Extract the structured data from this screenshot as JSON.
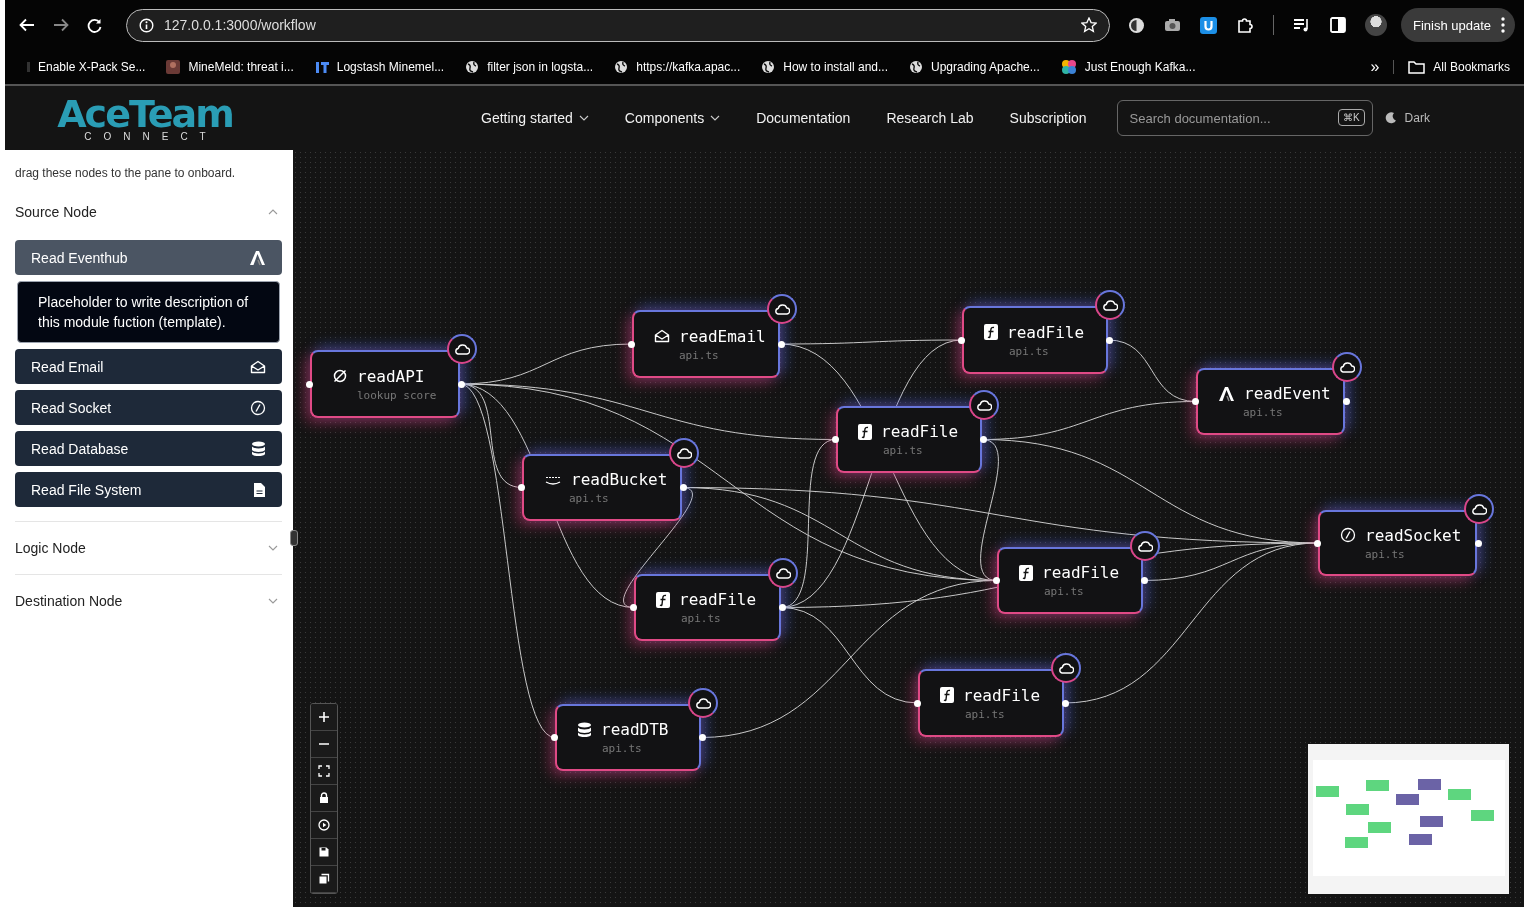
{
  "browser": {
    "url": "127.0.0.1:3000/workflow",
    "update_button": "Finish update",
    "bookmarks": [
      {
        "label": "Enable X-Pack Se...",
        "kind": "plain"
      },
      {
        "label": "MineMeld: threat i...",
        "kind": "photo"
      },
      {
        "label": "Logstash Minemel...",
        "kind": "bars"
      },
      {
        "label": "filter json in logsta...",
        "kind": "globe"
      },
      {
        "label": "https://kafka.apac...",
        "kind": "globe"
      },
      {
        "label": "How to install and...",
        "kind": "globe"
      },
      {
        "label": "Upgrading Apache...",
        "kind": "globe"
      },
      {
        "label": "Just Enough Kafka...",
        "kind": "colorful"
      }
    ],
    "more": "»",
    "all_bookmarks": "All Bookmarks"
  },
  "header": {
    "logo": "AceTeam",
    "logo_sub": "CONNECT",
    "nav": [
      {
        "label": "Getting started",
        "dropdown": true
      },
      {
        "label": "Components",
        "dropdown": true
      },
      {
        "label": "Documentation",
        "dropdown": false
      },
      {
        "label": "Research Lab",
        "dropdown": false
      },
      {
        "label": "Subscription",
        "dropdown": false
      }
    ],
    "search": {
      "placeholder": "Search documentation...",
      "shortcut": "⌘K"
    },
    "theme": "Dark"
  },
  "sidebar": {
    "hint": "drag these nodes to the pane to onboard.",
    "tooltip": "Placeholder to write description of this module fuction (template).",
    "sections": [
      {
        "title": "Source Node",
        "expanded": true,
        "items": [
          {
            "label": "Read Eventhub",
            "kind": "eventhub",
            "selected": true
          },
          {
            "label": "Read Email",
            "kind": "email",
            "selected": false
          },
          {
            "label": "Read Socket",
            "kind": "socket",
            "selected": false
          },
          {
            "label": "Read Database",
            "kind": "database",
            "selected": false
          },
          {
            "label": "Read File System",
            "kind": "file",
            "selected": false
          }
        ]
      },
      {
        "title": "Logic Node",
        "expanded": false
      },
      {
        "title": "Destination Node",
        "expanded": false
      }
    ]
  },
  "canvas": {
    "nodes": [
      {
        "label": "readAPI",
        "subtitle": "lookup score",
        "kind": "api"
      },
      {
        "label": "readEmail",
        "subtitle": "api.ts",
        "kind": "email"
      },
      {
        "label": "readFile",
        "subtitle": "api.ts",
        "kind": "function"
      },
      {
        "label": "readEvent",
        "subtitle": "api.ts",
        "kind": "eventhub"
      },
      {
        "label": "readFile",
        "subtitle": "api.ts",
        "kind": "function"
      },
      {
        "label": "readBucket",
        "subtitle": "api.ts",
        "kind": "bucket"
      },
      {
        "label": "readSocket",
        "subtitle": "api.ts",
        "kind": "socket"
      },
      {
        "label": "readFile",
        "subtitle": "api.ts",
        "kind": "function"
      },
      {
        "label": "readFile",
        "subtitle": "api.ts",
        "kind": "function"
      },
      {
        "label": "readFile",
        "subtitle": "api.ts",
        "kind": "function"
      },
      {
        "label": "readDTB",
        "subtitle": "api.ts",
        "kind": "database"
      }
    ]
  }
}
